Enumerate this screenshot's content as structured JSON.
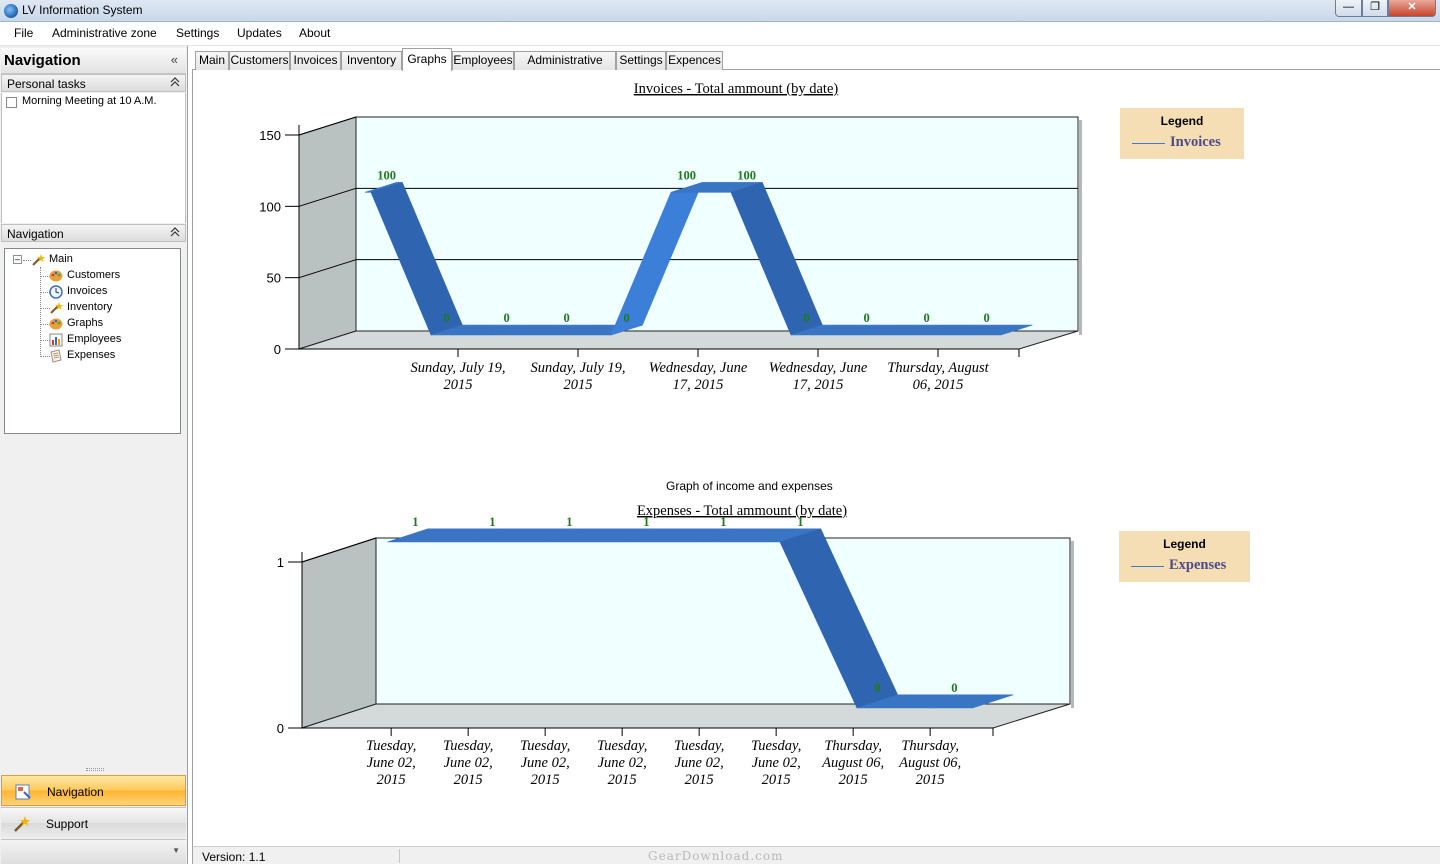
{
  "window": {
    "title": "LV Information System",
    "buttons": {
      "min": "—",
      "max": "❐",
      "close": "✕"
    }
  },
  "menu": [
    "File",
    "Administrative zone",
    "Settings",
    "Updates",
    "About"
  ],
  "nav_panel": {
    "title": "Navigation",
    "collapse_glyph": "«",
    "personal_tasks": {
      "header": "Personal tasks",
      "items": [
        {
          "label": "Morning Meeting at 10 A.M.",
          "checked": false
        }
      ]
    },
    "navigation_section": {
      "header": "Navigation"
    },
    "tree": {
      "root": "Main",
      "children": [
        "Customers",
        "Invoices",
        "Inventory",
        "Graphs",
        "Employees",
        "Expenses"
      ]
    },
    "buttons": [
      {
        "label": "Navigation",
        "active": true
      },
      {
        "label": "Support",
        "active": false
      }
    ]
  },
  "tabs": [
    {
      "label": "Main",
      "active": false
    },
    {
      "label": "Customers",
      "active": false
    },
    {
      "label": "Invoices",
      "active": false
    },
    {
      "label": "Inventory",
      "active": false
    },
    {
      "label": "Graphs",
      "active": true
    },
    {
      "label": "Employees",
      "active": false
    },
    {
      "label": "Administrative zone",
      "active": false
    },
    {
      "label": "Settings",
      "active": false
    },
    {
      "label": "Expences",
      "active": false
    }
  ],
  "section_caption": "Graph of income and expenses",
  "status": {
    "version": "Version: 1.1",
    "watermark": "GearDownload.com"
  },
  "colors": {
    "series": "#3a75c4",
    "plot_bg": "#f0ffff",
    "wall": "#b9c1c1",
    "floor": "#d3dad9",
    "label": "#1e7a1e",
    "legend_bg": "#f5deb3"
  },
  "chart_data": [
    {
      "type": "line",
      "style": "3d-ribbon",
      "title": "Invoices - Total ammount (by date)",
      "legend_title": "Legend",
      "legend_position": "top-right",
      "ylim": [
        0,
        150
      ],
      "yticks": [
        0,
        50,
        100,
        150
      ],
      "grid": true,
      "x_labels": [
        "Sunday, July 19, 2015",
        "Sunday, July 19, 2015",
        "Wednesday, June 17, 2015",
        "Wednesday, June 17, 2015",
        "Thursday, August 06, 2015"
      ],
      "series": [
        {
          "name": "Invoices",
          "values": [
            100,
            0,
            0,
            0,
            0,
            100,
            100,
            0,
            0,
            0,
            0
          ]
        }
      ]
    },
    {
      "type": "line",
      "style": "3d-ribbon",
      "title": "Expenses - Total ammount (by date)",
      "legend_title": "Legend",
      "legend_position": "top-right",
      "ylim": [
        0,
        1
      ],
      "yticks": [
        0,
        1
      ],
      "grid": true,
      "x_labels": [
        "Tuesday, June 02, 2015",
        "Tuesday, June 02, 2015",
        "Tuesday, June 02, 2015",
        "Tuesday, June 02, 2015",
        "Tuesday, June 02, 2015",
        "Tuesday, June 02, 2015",
        "Thursday, August 06, 2015",
        "Thursday, August 06, 2015"
      ],
      "series": [
        {
          "name": "Expenses",
          "values": [
            1,
            1,
            1,
            1,
            1,
            1,
            0,
            0
          ]
        }
      ]
    }
  ]
}
